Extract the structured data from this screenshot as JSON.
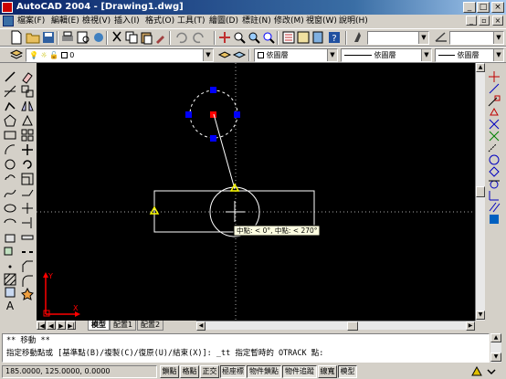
{
  "app": {
    "title": "AutoCAD 2004 - [Drawing1.dwg]"
  },
  "menu": {
    "items": [
      "檔案(F)",
      "編輯(E)",
      "檢視(V)",
      "插入(I)",
      "格式(O)",
      "工具(T)",
      "繪圖(D)",
      "標註(N)",
      "修改(M)",
      "視窗(W)",
      "說明(H)"
    ]
  },
  "properties": {
    "layer_value": "0",
    "color_value": "依圖層",
    "linetype_value": "依圖層",
    "lineweight_value": "依圖層"
  },
  "drawing": {
    "tooltip": "中點: < 0°, 中點: < 270°",
    "ucs_x_label": "X",
    "ucs_y_label": "Y",
    "colors": {
      "background": "#000000",
      "geometry": "#ffffff",
      "grip_hot": "#ff0000",
      "grip_cold": "#0000ff",
      "osnap_marker": "#ffff00",
      "ucs_icon": "#ff0000"
    }
  },
  "tabs": {
    "items": [
      "模型",
      "配置1",
      "配置2"
    ],
    "active": "模型"
  },
  "command": {
    "line1": "** 移動 **",
    "line2": "指定移動點或 [基準點(B)/複製(C)/復原(U)/結束(X)]: _tt 指定暫時的 OTRACK 點:"
  },
  "status": {
    "coordinates": "185.0000, 125.0000, 0.0000",
    "buttons": [
      {
        "label": "鎖點",
        "pressed": false
      },
      {
        "label": "格點",
        "pressed": false
      },
      {
        "label": "正交",
        "pressed": false
      },
      {
        "label": "極座標",
        "pressed": true
      },
      {
        "label": "物件鎖點",
        "pressed": true
      },
      {
        "label": "物件追蹤",
        "pressed": true
      },
      {
        "label": "線寬",
        "pressed": false
      },
      {
        "label": "模型",
        "pressed": true
      }
    ]
  }
}
